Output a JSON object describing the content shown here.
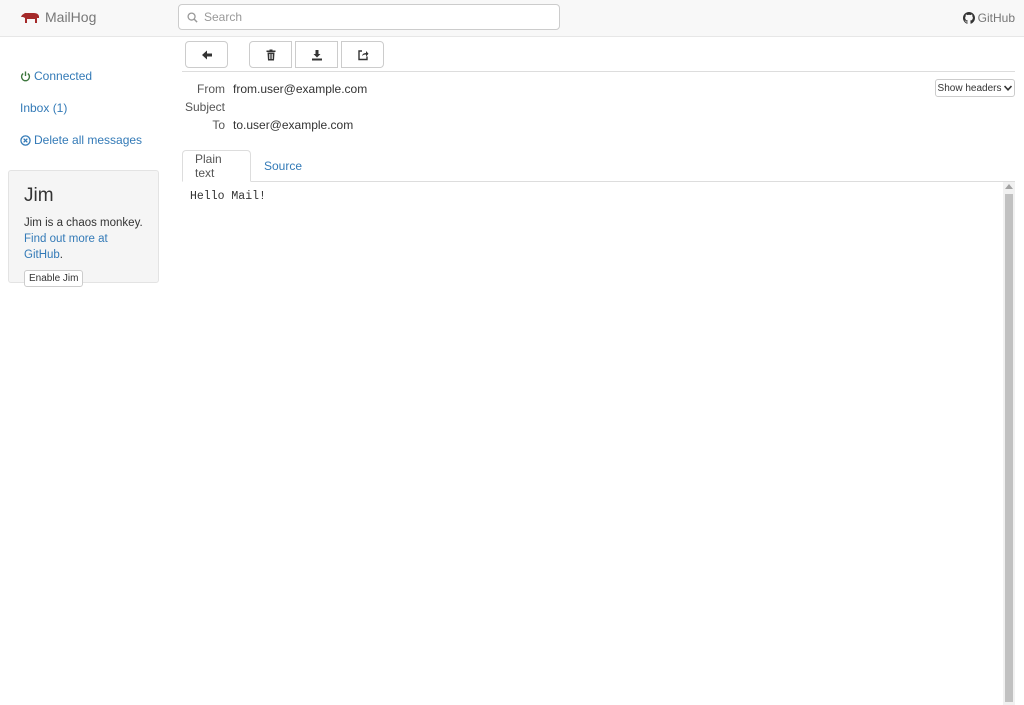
{
  "navbar": {
    "brand": "MailHog",
    "search_placeholder": "Search",
    "github_label": "GitHub"
  },
  "sidebar": {
    "connected_label": "Connected",
    "inbox_label": "Inbox (1)",
    "delete_all_label": "Delete all messages"
  },
  "jim": {
    "title": "Jim",
    "description": "Jim is a chaos monkey.",
    "link_text": "Find out more at GitHub",
    "period": ".",
    "button_label": "Enable Jim"
  },
  "message": {
    "from_label": "From",
    "from_value": "from.user@example.com",
    "subject_label": "Subject",
    "subject_value": "",
    "to_label": "To",
    "to_value": "to.user@example.com",
    "show_headers_label": "Show headers",
    "body": "Hello Mail!"
  },
  "tabs": [
    {
      "label": "Plain text",
      "active": true
    },
    {
      "label": "Source",
      "active": false
    }
  ],
  "colors": {
    "link": "#337ab7",
    "connected": "#3c763d",
    "brand_icon": "#a52a2a"
  }
}
